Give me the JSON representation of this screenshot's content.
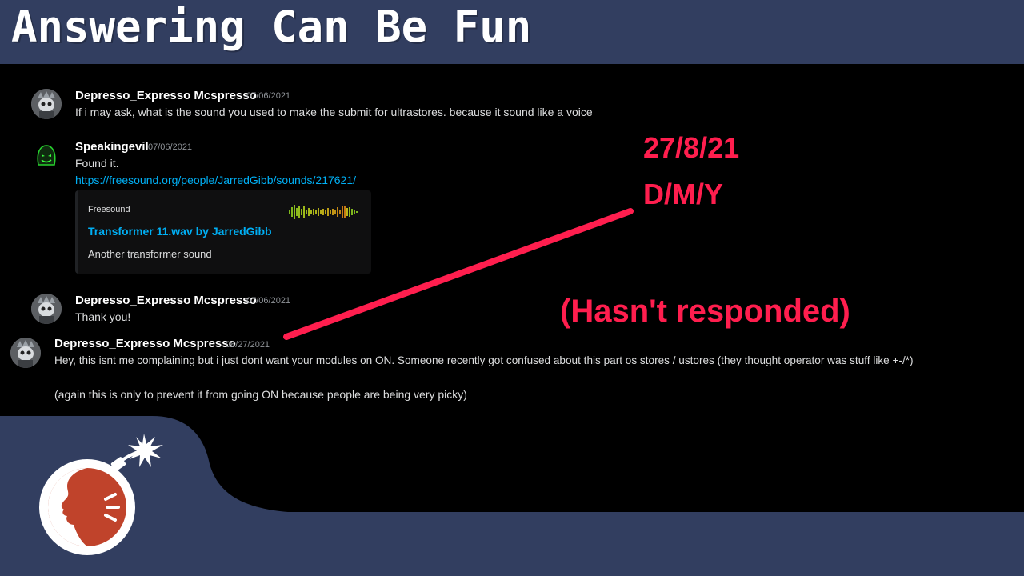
{
  "page_title": "Answering Can Be Fun",
  "colors": {
    "frame": "#323e60",
    "panel": "#000000",
    "annotation": "#ff1e4e",
    "link": "#00aff4",
    "username": "#ffffff",
    "timestamp": "#8e9297"
  },
  "messages": [
    {
      "avatar_icon": "skull-avatar-icon",
      "username": "Depresso_Expresso Mcspresso",
      "timestamp": "07/06/2021",
      "text": "If i may ask, what is the sound you used to make the submit for ultrastores. because it sound like a voice"
    },
    {
      "avatar_icon": "green-ghost-avatar-icon",
      "username": "Speakingevil",
      "timestamp": "07/06/2021",
      "text": "Found it.",
      "link": "https://freesound.org/people/JarredGibb/sounds/217621/",
      "embed": {
        "provider": "Freesound",
        "title": "Transformer 11.wav by JarredGibb",
        "description": "Another transformer sound",
        "thumbnail_icon": "waveform-thumbnail-icon"
      }
    },
    {
      "avatar_icon": "skull-avatar-icon",
      "username": "Depresso_Expresso Mcspresso",
      "timestamp": "07/06/2021",
      "text": "Thank you!"
    },
    {
      "avatar_icon": "skull-avatar-icon",
      "username": "Depresso_Expresso Mcspresso",
      "timestamp": "08/27/2021",
      "text": "Hey, this isnt me complaining but i just dont want your modules on ON. Someone recently got confused about this part os stores / ustores (they thought operator was stuff like +-/*)",
      "text2": "(again this is only to prevent it from going ON because people are being very picky)"
    }
  ],
  "annotations": {
    "date": "27/8/21",
    "format": "D/M/Y",
    "note": "(Hasn't responded)"
  },
  "logo_icon": "bomb-speaking-face-logo-icon"
}
